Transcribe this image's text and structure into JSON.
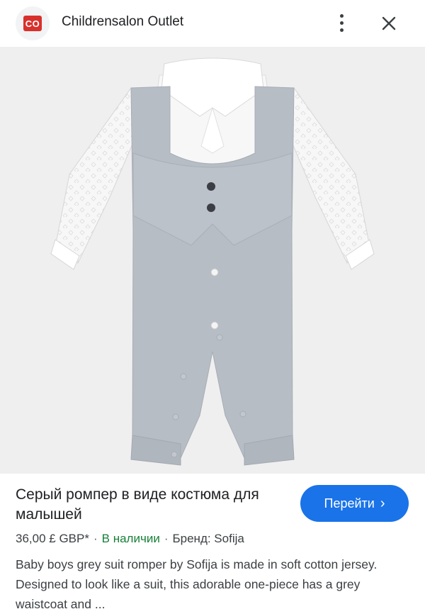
{
  "header": {
    "logo_text": "CO",
    "site_name": "Childrensalon Outlet"
  },
  "product_image": {
    "subject": "grey suit romper with white shirt",
    "colors": {
      "body": "#b7bdc5",
      "shirt": "#f7f7f7",
      "background": "#efefef"
    }
  },
  "product": {
    "title": "Серый ромпер в виде костюма для малышей",
    "price": "36,00 £ GBP*",
    "availability": "В наличии",
    "brand": "Бренд: Sofija",
    "description": "Baby boys grey suit romper by Sofija is made in soft cotton jersey. Designed to look like a suit, this adorable one-piece has a grey waistcoat and ..."
  },
  "actions": {
    "go_label": "Перейти"
  },
  "colors": {
    "accent": "#1a73e8",
    "in_stock": "#188038",
    "logo": "#d8312d"
  },
  "icons": [
    "more-vert-icon",
    "close-icon",
    "chevron-right-icon"
  ]
}
